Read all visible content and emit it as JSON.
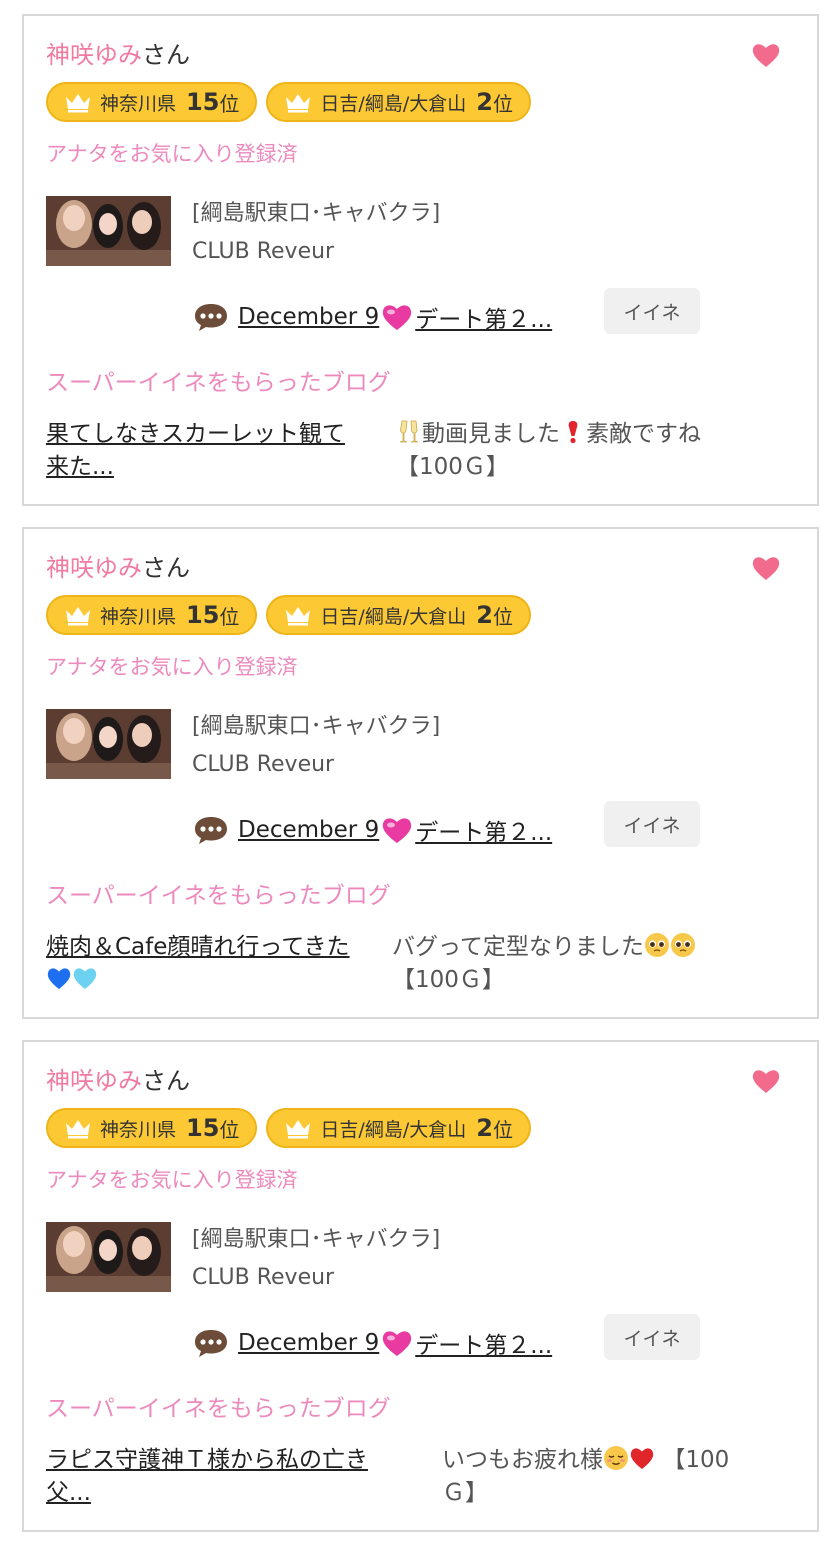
{
  "cards": [
    {
      "name": "神咲ゆみ",
      "suffix": "さん",
      "badges": [
        {
          "area": "神奈川県",
          "rank": "15",
          "suffix": "位"
        },
        {
          "area": "日吉/綱島/大倉山",
          "rank": "2",
          "suffix": "位"
        }
      ],
      "fav_status": "アナタをお気に入り登録済",
      "shop_category": "[綱島駅東口･キャバクラ]",
      "shop_name": "CLUB Reveur",
      "blog_date": "December 9",
      "blog_title": "デート第２...",
      "ine_label": "イイネ",
      "super_title": "スーパーイイネをもらったブログ",
      "super_blog_line1": "果てしなきスカーレット観て",
      "super_blog_line2": "来た...",
      "super_comment_line1": "動画見ました",
      "super_comment_line1b": "素敵ですね",
      "super_comment_line2": "【100Ｇ】"
    },
    {
      "name": "神咲ゆみ",
      "suffix": "さん",
      "badges": [
        {
          "area": "神奈川県",
          "rank": "15",
          "suffix": "位"
        },
        {
          "area": "日吉/綱島/大倉山",
          "rank": "2",
          "suffix": "位"
        }
      ],
      "fav_status": "アナタをお気に入り登録済",
      "shop_category": "[綱島駅東口･キャバクラ]",
      "shop_name": "CLUB Reveur",
      "blog_date": "December 9",
      "blog_title": "デート第２...",
      "ine_label": "イイネ",
      "super_title": "スーパーイイネをもらったブログ",
      "super_blog_line1": "焼肉＆Cafe顔晴れ行ってきた",
      "super_comment_line1": "バグって定型なりました",
      "super_comment_line2": "【100Ｇ】"
    },
    {
      "name": "神咲ゆみ",
      "suffix": "さん",
      "badges": [
        {
          "area": "神奈川県",
          "rank": "15",
          "suffix": "位"
        },
        {
          "area": "日吉/綱島/大倉山",
          "rank": "2",
          "suffix": "位"
        }
      ],
      "fav_status": "アナタをお気に入り登録済",
      "shop_category": "[綱島駅東口･キャバクラ]",
      "shop_name": "CLUB Reveur",
      "blog_date": "December 9",
      "blog_title": "デート第２...",
      "ine_label": "イイネ",
      "super_title": "スーパーイイネをもらったブログ",
      "super_blog_line1": "ラピス守護神Ｔ様から私の亡き",
      "super_blog_line2": "父...",
      "super_comment_line1": "いつもお疲れ様",
      "super_comment_line1b": "【100",
      "super_comment_line2": "Ｇ】"
    }
  ],
  "colors": {
    "name_pink": "#f07aa0",
    "heart": "#f36b8c",
    "badge_yellow": "#fcc935",
    "link_pink": "#ec8abd"
  },
  "icons": [
    "heart-icon",
    "crown-icon",
    "chat-bubble-icon",
    "pink-heart-emoji",
    "champagne-emoji",
    "exclamation-emoji",
    "pleading-face-emoji",
    "blue-heart-emoji",
    "light-blue-heart-emoji",
    "relieved-face-emoji",
    "red-heart-emoji"
  ]
}
